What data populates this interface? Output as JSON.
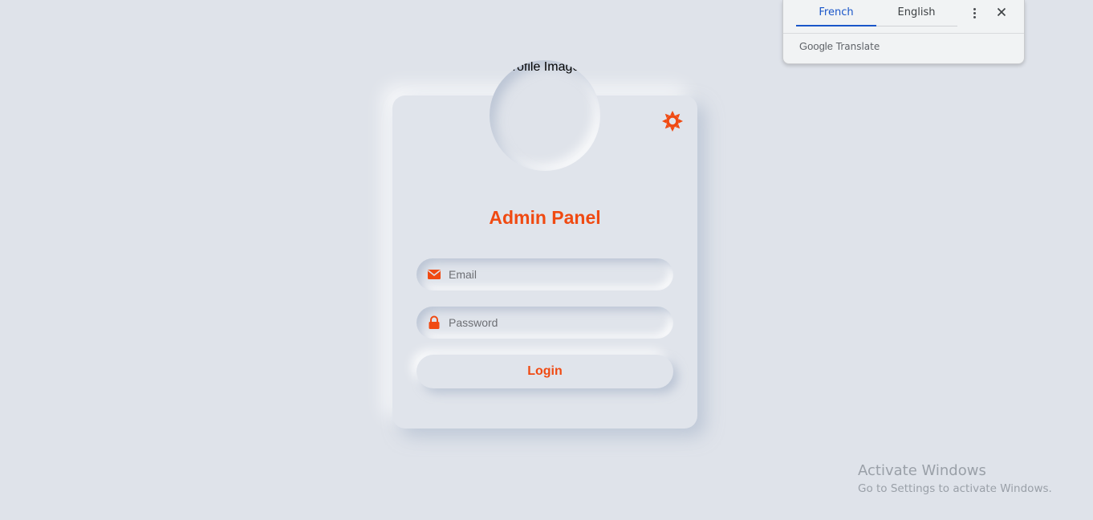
{
  "translate_bar": {
    "tabs": [
      {
        "label": "French",
        "active": true
      },
      {
        "label": "English",
        "active": false
      }
    ],
    "brand_google": "Google",
    "brand_translate": "Translate",
    "more_icon": "more-vert-icon",
    "close_icon": "close-icon"
  },
  "login_card": {
    "profile_image_alt": "Profile Image",
    "theme_icon": "sun-icon",
    "title": "Admin Panel",
    "email": {
      "placeholder": "Email",
      "value": "",
      "icon": "envelope-icon"
    },
    "password": {
      "placeholder": "Password",
      "value": "",
      "icon": "lock-icon"
    },
    "login_label": "Login"
  },
  "colors": {
    "accent": "#f04a12",
    "background": "#dfe3ea",
    "translate_active": "#1a56c9"
  },
  "watermark": {
    "line1": "Activate Windows",
    "line2": "Go to Settings to activate Windows."
  }
}
